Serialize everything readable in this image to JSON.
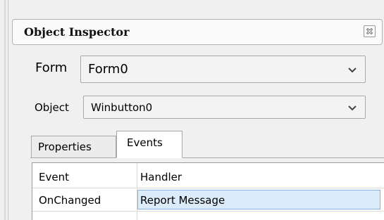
{
  "window": {
    "title": "Object Inspector",
    "close_icon": "close-icon"
  },
  "form_row": {
    "label": "Form",
    "value": "Form0"
  },
  "object_row": {
    "label": "Object",
    "value": "Winbutton0"
  },
  "tabs": [
    {
      "label": "Properties",
      "active": false
    },
    {
      "label": "Events",
      "active": true
    }
  ],
  "grid": {
    "headers": [
      "Event",
      "Handler"
    ],
    "rows": [
      {
        "event": "OnChanged",
        "handler": "Report Message",
        "selected": true
      }
    ]
  },
  "colors": {
    "selection_fill": "#dcebfa",
    "selection_border": "#7eb4ea"
  }
}
